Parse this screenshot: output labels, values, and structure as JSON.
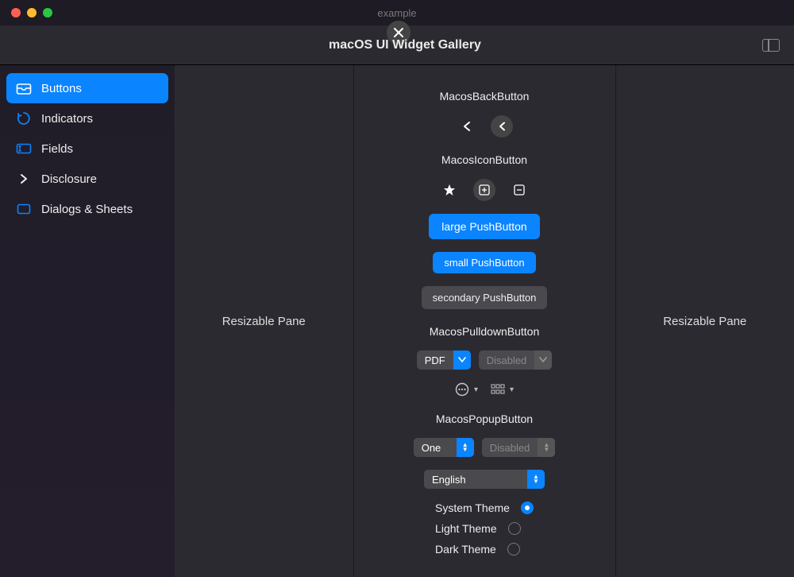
{
  "window": {
    "title": "example"
  },
  "toolbar": {
    "title": "macOS UI Widget Gallery"
  },
  "sidebar": {
    "items": [
      {
        "label": "Buttons",
        "active": true
      },
      {
        "label": "Indicators",
        "active": false
      },
      {
        "label": "Fields",
        "active": false
      },
      {
        "label": "Disclosure",
        "active": false
      },
      {
        "label": "Dialogs & Sheets",
        "active": false
      }
    ]
  },
  "panes": {
    "left": "Resizable Pane",
    "right": "Resizable Pane"
  },
  "sections": {
    "back": "MacosBackButton",
    "icon": "MacosIconButton",
    "pulldown": "MacosPulldownButton",
    "popup": "MacosPopupButton"
  },
  "buttons": {
    "large": "large PushButton",
    "small": "small PushButton",
    "secondary": "secondary PushButton"
  },
  "pulldown": {
    "pdf": "PDF",
    "disabled": "Disabled"
  },
  "popup": {
    "one": "One",
    "disabled": "Disabled",
    "english": "English"
  },
  "radios": {
    "system": "System Theme",
    "light": "Light Theme",
    "dark": "Dark Theme"
  }
}
